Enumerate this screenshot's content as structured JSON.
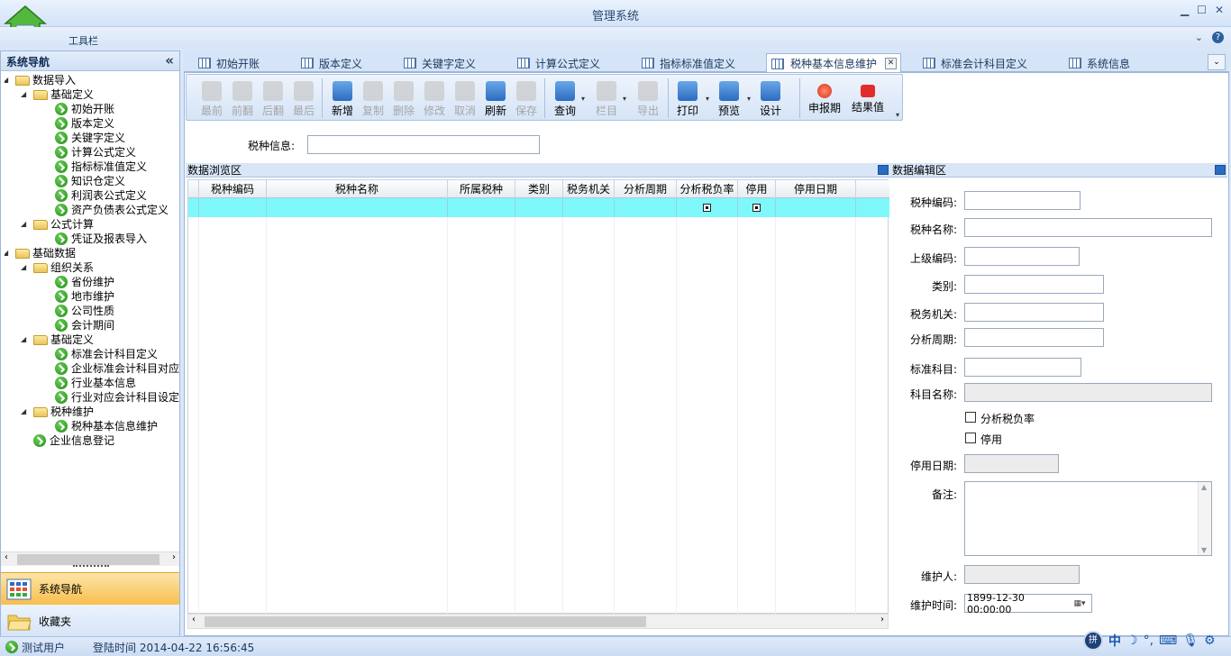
{
  "app": {
    "title": "管理系统",
    "toolbar_label": "工具栏"
  },
  "sidebar": {
    "title": "系统导航",
    "collapse": "«",
    "tree": [
      {
        "label": "数据导入",
        "level": 0,
        "type": "folder"
      },
      {
        "label": "基础定义",
        "level": 1,
        "type": "folder"
      },
      {
        "label": "初始开账",
        "level": 2,
        "type": "leaf"
      },
      {
        "label": "版本定义",
        "level": 2,
        "type": "leaf"
      },
      {
        "label": "关键字定义",
        "level": 2,
        "type": "leaf"
      },
      {
        "label": "计算公式定义",
        "level": 2,
        "type": "leaf"
      },
      {
        "label": "指标标准值定义",
        "level": 2,
        "type": "leaf"
      },
      {
        "label": "知识仓定义",
        "level": 2,
        "type": "leaf"
      },
      {
        "label": "利润表公式定义",
        "level": 2,
        "type": "leaf"
      },
      {
        "label": "资产负债表公式定义",
        "level": 2,
        "type": "leaf"
      },
      {
        "label": "公式计算",
        "level": 1,
        "type": "folder"
      },
      {
        "label": "凭证及报表导入",
        "level": 2,
        "type": "leaf"
      },
      {
        "label": "基础数据",
        "level": 0,
        "type": "folder"
      },
      {
        "label": "组织关系",
        "level": 1,
        "type": "folder"
      },
      {
        "label": "省份维护",
        "level": 2,
        "type": "leaf"
      },
      {
        "label": "地市维护",
        "level": 2,
        "type": "leaf"
      },
      {
        "label": "公司性质",
        "level": 2,
        "type": "leaf"
      },
      {
        "label": "会计期间",
        "level": 2,
        "type": "leaf"
      },
      {
        "label": "基础定义",
        "level": 1,
        "type": "folder"
      },
      {
        "label": "标准会计科目定义",
        "level": 2,
        "type": "leaf"
      },
      {
        "label": "企业标准会计科目对应",
        "level": 2,
        "type": "leaf"
      },
      {
        "label": "行业基本信息",
        "level": 2,
        "type": "leaf"
      },
      {
        "label": "行业对应会计科目设定",
        "level": 2,
        "type": "leaf"
      },
      {
        "label": "税种维护",
        "level": 1,
        "type": "folder"
      },
      {
        "label": "税种基本信息维护",
        "level": 2,
        "type": "leaf"
      },
      {
        "label": "企业信息登记",
        "level": 1,
        "type": "leaf"
      }
    ],
    "nav_system": "系统导航",
    "nav_favorites": "收藏夹"
  },
  "tabs": [
    {
      "label": "初始开账"
    },
    {
      "label": "版本定义"
    },
    {
      "label": "关键字定义"
    },
    {
      "label": "计算公式定义"
    },
    {
      "label": "指标标准值定义"
    },
    {
      "label": "税种基本信息维护",
      "active": true
    },
    {
      "label": "标准会计科目定义"
    },
    {
      "label": "系统信息"
    }
  ],
  "toolbar": {
    "buttons": [
      {
        "label": "最前",
        "enabled": false
      },
      {
        "label": "前翻",
        "enabled": false
      },
      {
        "label": "后翻",
        "enabled": false
      },
      {
        "label": "最后",
        "enabled": false
      },
      {
        "label": "新增",
        "enabled": true
      },
      {
        "label": "复制",
        "enabled": false
      },
      {
        "label": "删除",
        "enabled": false
      },
      {
        "label": "修改",
        "enabled": false
      },
      {
        "label": "取消",
        "enabled": false
      },
      {
        "label": "刷新",
        "enabled": true
      },
      {
        "label": "保存",
        "enabled": false
      },
      {
        "label": "查询",
        "enabled": true
      },
      {
        "label": "栏目",
        "enabled": false
      },
      {
        "label": "导出",
        "enabled": false
      },
      {
        "label": "打印",
        "enabled": true
      },
      {
        "label": "预览",
        "enabled": true
      },
      {
        "label": "设计",
        "enabled": true
      },
      {
        "label": "申报期",
        "enabled": true
      },
      {
        "label": "结果值",
        "enabled": true
      }
    ]
  },
  "filter": {
    "label": "税种信息:",
    "value": ""
  },
  "browse": {
    "title": "数据浏览区",
    "columns": [
      "税种编码",
      "税种名称",
      "所属税种",
      "类别",
      "税务机关",
      "分析周期",
      "分析税负率",
      "停用",
      "停用日期"
    ],
    "rows": [
      {
        "税种编码": "",
        "税种名称": "",
        "所属税种": "",
        "类别": "",
        "税务机关": "",
        "分析周期": "",
        "分析税负率": false,
        "停用": false,
        "停用日期": ""
      }
    ]
  },
  "edit": {
    "title": "数据编辑区",
    "fields": {
      "tax_code": {
        "label": "税种编码:",
        "value": ""
      },
      "tax_name": {
        "label": "税种名称:",
        "value": ""
      },
      "parent_code": {
        "label": "上级编码:",
        "value": ""
      },
      "category": {
        "label": "类别:",
        "value": ""
      },
      "tax_authority": {
        "label": "税务机关:",
        "value": ""
      },
      "period": {
        "label": "分析周期:",
        "value": ""
      },
      "std_subject": {
        "label": "标准科目:",
        "value": ""
      },
      "subject_name": {
        "label": "科目名称:",
        "value": ""
      },
      "analyze_rate": {
        "label": "分析税负率",
        "checked": false
      },
      "disabled": {
        "label": "停用",
        "checked": false
      },
      "disable_date": {
        "label": "停用日期:",
        "value": ""
      },
      "remark": {
        "label": "备注:",
        "value": ""
      },
      "maintainer": {
        "label": "维护人:",
        "value": ""
      },
      "maintain_time": {
        "label": "维护时间:",
        "value": "1899-12-30 00:00:00"
      }
    }
  },
  "status": {
    "user": "测试用户",
    "login": "登陆时间 2014-04-22 16:56:45"
  },
  "ime": {
    "mode": "中"
  }
}
